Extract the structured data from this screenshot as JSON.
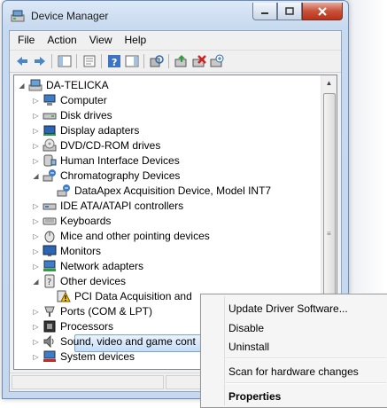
{
  "window": {
    "title": "Device Manager"
  },
  "menu": [
    "File",
    "Action",
    "View",
    "Help"
  ],
  "tree": {
    "root": "DA-TELICKA",
    "items": [
      {
        "label": "Computer",
        "icon": "computer-icon"
      },
      {
        "label": "Disk drives",
        "icon": "disk-drive-icon"
      },
      {
        "label": "Display adapters",
        "icon": "display-adapter-icon"
      },
      {
        "label": "DVD/CD-ROM drives",
        "icon": "dvd-drive-icon"
      },
      {
        "label": "Human Interface Devices",
        "icon": "hid-icon"
      },
      {
        "label": "Chromatography Devices",
        "icon": "chromatography-icon"
      },
      {
        "label": "DataApex Acquisition Device, Model INT7",
        "icon": "acquisition-device-icon"
      },
      {
        "label": "IDE ATA/ATAPI controllers",
        "icon": "ide-controller-icon"
      },
      {
        "label": "Keyboards",
        "icon": "keyboard-icon"
      },
      {
        "label": "Mice and other pointing devices",
        "icon": "mouse-icon"
      },
      {
        "label": "Monitors",
        "icon": "monitor-icon"
      },
      {
        "label": "Network adapters",
        "icon": "network-adapter-icon"
      },
      {
        "label": "Other devices",
        "icon": "other-devices-icon"
      },
      {
        "label": "PCI Data Acquisition and",
        "icon": "warning-device-icon"
      },
      {
        "label": "Ports (COM & LPT)",
        "icon": "port-icon"
      },
      {
        "label": "Processors",
        "icon": "processor-icon"
      },
      {
        "label": "Sound, video and game cont",
        "icon": "sound-icon"
      },
      {
        "label": "System devices",
        "icon": "system-device-icon"
      }
    ]
  },
  "context_menu": {
    "update": "Update Driver Software...",
    "disable": "Disable",
    "uninstall": "Uninstall",
    "scan": "Scan for hardware changes",
    "properties": "Properties"
  },
  "colors": {
    "selection": "#c4ddf8",
    "warning": "#f5c400",
    "accent": "#1f5fb5"
  }
}
